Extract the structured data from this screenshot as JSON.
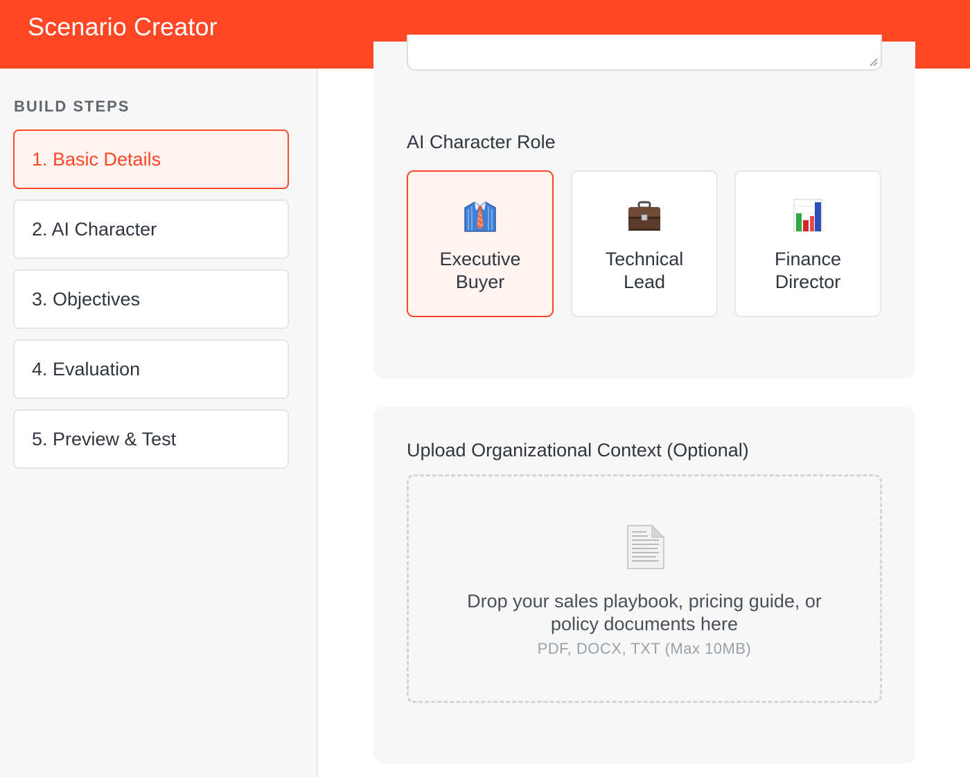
{
  "app": {
    "title": "Scenario Creator"
  },
  "colors": {
    "accent": "#ff4726",
    "selected_bg": "#fff3f0",
    "panel_bg": "#f7f7f7"
  },
  "sidebar": {
    "heading": "BUILD STEPS",
    "steps": [
      {
        "label": "1. Basic Details",
        "active": true
      },
      {
        "label": "2. AI Character",
        "active": false
      },
      {
        "label": "3. Objectives",
        "active": false
      },
      {
        "label": "4. Evaluation",
        "active": false
      },
      {
        "label": "5. Preview & Test",
        "active": false
      }
    ]
  },
  "character_role": {
    "label": "AI Character Role",
    "options": [
      {
        "line1": "Executive",
        "line2": "Buyer",
        "icon": "shirt-tie-icon",
        "selected": true
      },
      {
        "line1": "Technical",
        "line2": "Lead",
        "icon": "briefcase-icon",
        "selected": false
      },
      {
        "line1": "Finance",
        "line2": "Director",
        "icon": "bar-chart-icon",
        "selected": false
      }
    ]
  },
  "upload": {
    "label": "Upload Organizational Context (Optional)",
    "icon": "document-icon",
    "drop_text_line1": "Drop your sales playbook, pricing guide, or",
    "drop_text_line2": "policy documents here",
    "hint": "PDF, DOCX, TXT (Max 10MB)"
  }
}
